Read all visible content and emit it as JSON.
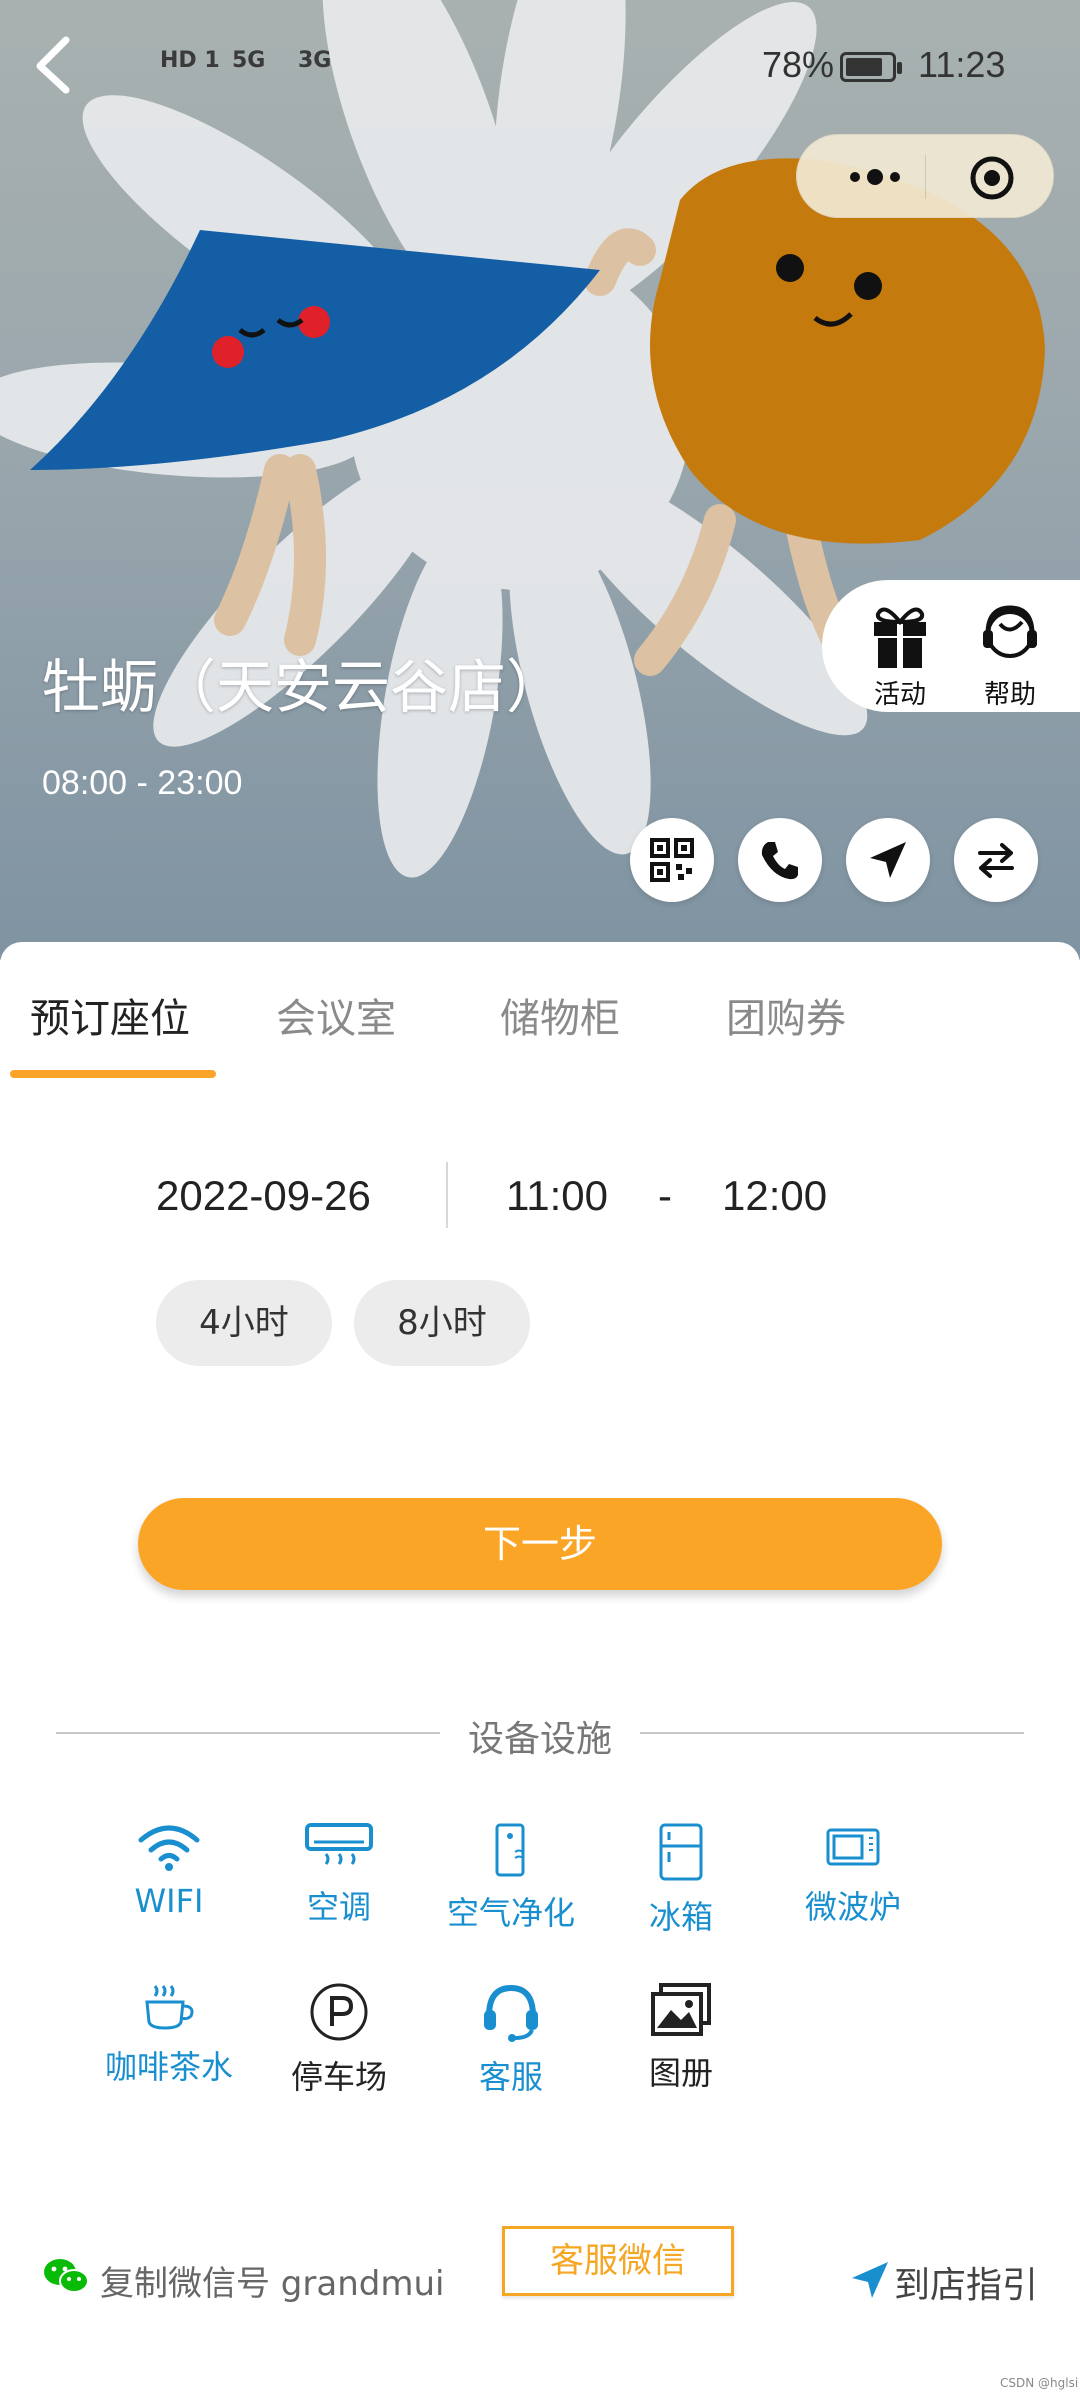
{
  "status_bar": {
    "signal_1": "HD 1",
    "signal_2": "5G",
    "signal_3": "3G",
    "battery_text": "78%",
    "time": "11:23"
  },
  "hero": {
    "store_name": "牡蛎（天安云谷店）",
    "hours": "08:00 - 23:00"
  },
  "side_panel": {
    "activity_label": "活动",
    "help_label": "帮助"
  },
  "tabs": [
    {
      "label": "预订座位",
      "active": true
    },
    {
      "label": "会议室",
      "active": false
    },
    {
      "label": "储物柜",
      "active": false
    },
    {
      "label": "团购券",
      "active": false
    }
  ],
  "booking": {
    "date": "2022-09-26",
    "start_time": "11:00",
    "range_sep": "-",
    "end_time": "12:00",
    "durations": [
      "4小时",
      "8小时"
    ],
    "next_label": "下一步"
  },
  "facilities": {
    "title": "设备设施",
    "items": [
      {
        "label": "WIFI",
        "icon": "wifi-icon",
        "color": "#1a8fd0"
      },
      {
        "label": "空调",
        "icon": "air-conditioner-icon",
        "color": "#1a8fd0"
      },
      {
        "label": "空气净化",
        "icon": "air-purifier-icon",
        "color": "#1a8fd0"
      },
      {
        "label": "冰箱",
        "icon": "fridge-icon",
        "color": "#1a8fd0"
      },
      {
        "label": "微波炉",
        "icon": "microwave-icon",
        "color": "#1a8fd0"
      },
      {
        "label": "咖啡茶水",
        "icon": "coffee-icon",
        "color": "#1a8fd0"
      },
      {
        "label": "停车场",
        "icon": "parking-icon",
        "color": "#222222"
      },
      {
        "label": "客服",
        "icon": "headset-icon",
        "color": "#1a8fd0"
      },
      {
        "label": "图册",
        "icon": "gallery-icon",
        "color": "#222222"
      }
    ]
  },
  "footer": {
    "copy_wechat": "复制微信号 grandmui",
    "service_wechat": "客服微信",
    "guide": "到店指引"
  },
  "watermark": "CSDN @hglsi",
  "colors": {
    "accent": "#fba526",
    "facility_blue": "#1a8fd0",
    "wechat_green": "#09bb07"
  }
}
